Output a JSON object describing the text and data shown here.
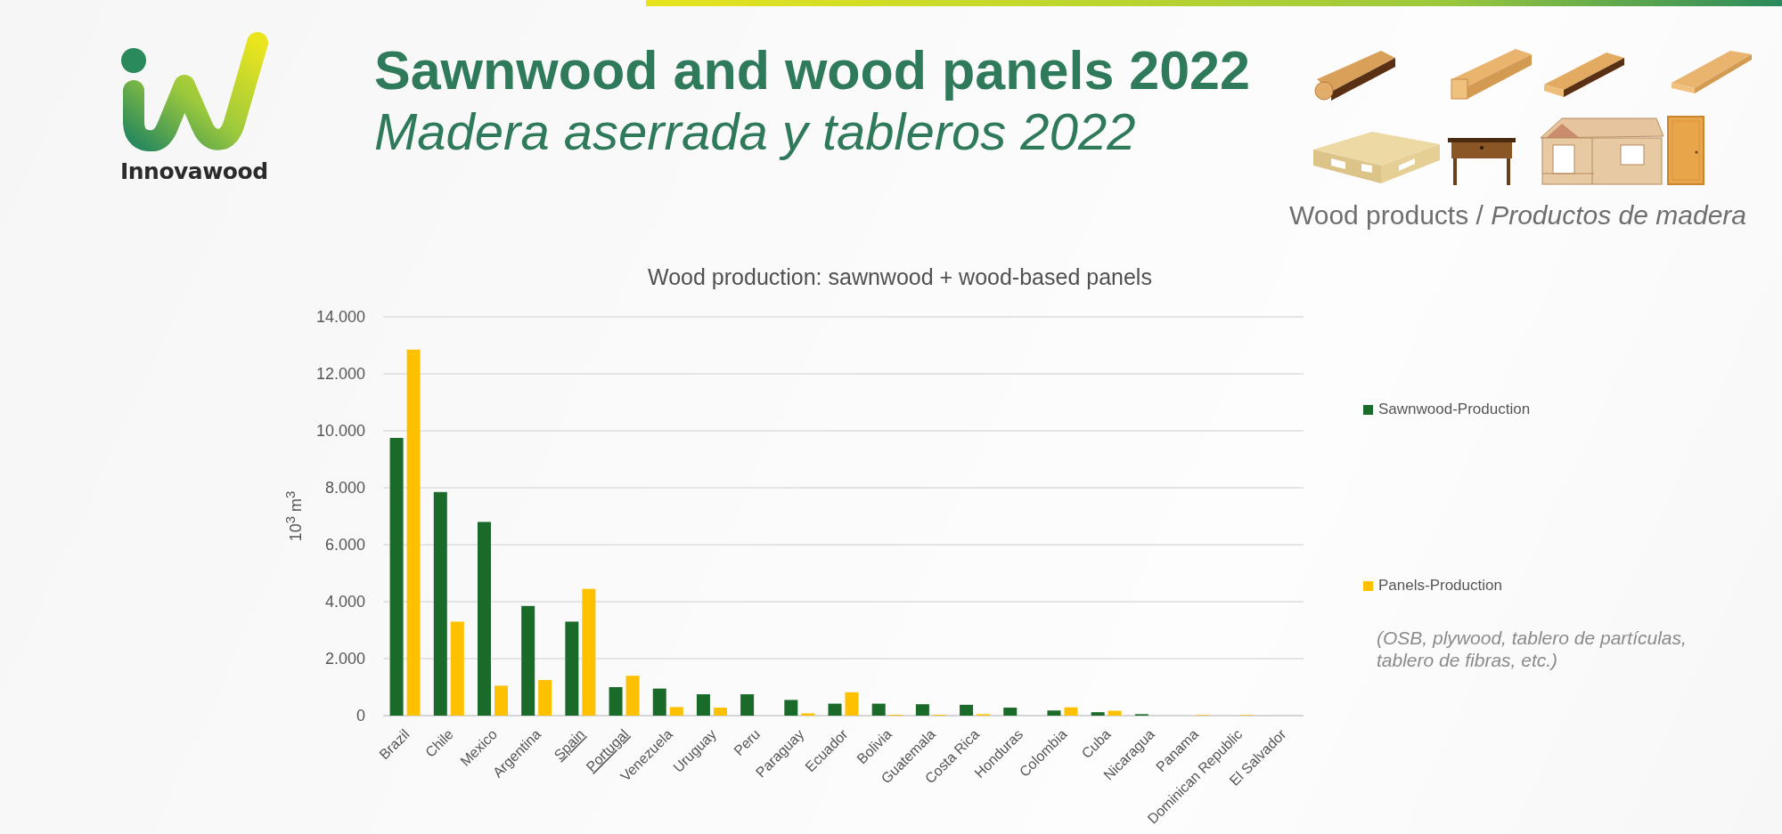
{
  "header": {
    "logo_text": "Innovawood",
    "title": "Sawnwood and wood panels 2022",
    "subtitle": "Madera aserrada y tableros 2022"
  },
  "products": {
    "caption": "Wood products / *Productos de madera*"
  },
  "chart": {
    "note": "(OSB, plywood, tablero de partículas, tablero de fibras, etc.)",
    "chart_data": {
      "type": "bar",
      "title": "Wood production: sawnwood + wood-based panels",
      "ylabel": "10$^{3}$ m$^{3}$",
      "categories": [
        "Brazil",
        "Chile",
        "Mexico",
        "Argentina",
        "Spain",
        "Portugal",
        "Venezuela",
        "Uruguay",
        "Peru",
        "Paraguay",
        "Ecuador",
        "Bolivia",
        "Guatemala",
        "Costa Rica",
        "Honduras",
        "Colombia",
        "Cuba",
        "Nicaragua",
        "Panama",
        "Dominican Republic",
        "El Salvador"
      ],
      "series": [
        {
          "name": "Sawnwood-Production",
          "color": "#1a6b2a",
          "values": [
            9750,
            7850,
            6800,
            3850,
            3300,
            1000,
            950,
            750,
            750,
            550,
            420,
            420,
            400,
            380,
            280,
            180,
            120,
            50,
            null,
            0,
            0
          ]
        },
        {
          "name": "Panels-Production",
          "color": "#ffc000",
          "values": [
            12850,
            3300,
            1050,
            1250,
            4450,
            1400,
            300,
            280,
            0,
            80,
            820,
            30,
            30,
            50,
            null,
            290,
            170,
            null,
            20,
            20,
            0
          ]
        }
      ],
      "ylim": [
        0,
        14000
      ],
      "grid": true,
      "legend": true,
      "yticks": [
        {
          "value": 0,
          "label": "0"
        },
        {
          "value": 2000,
          "label": "2.000"
        },
        {
          "value": 4000,
          "label": "4.000"
        },
        {
          "value": 6000,
          "label": "6.000"
        },
        {
          "value": 8000,
          "label": "8.000"
        },
        {
          "value": 10000,
          "label": "10.000"
        },
        {
          "value": 12000,
          "label": "12.000"
        },
        {
          "value": 14000,
          "label": "14.000"
        }
      ]
    },
    "category_underlines": [
      {
        "underlined": false
      },
      {
        "underlined": false
      },
      {
        "underlined": false
      },
      {
        "underlined": false
      },
      {
        "underlined": true
      },
      {
        "underlined": true
      },
      {
        "underlined": false
      },
      {
        "underlined": false
      },
      {
        "underlined": false
      },
      {
        "underlined": false
      },
      {
        "underlined": false
      },
      {
        "underlined": false
      },
      {
        "underlined": false
      },
      {
        "underlined": false
      },
      {
        "underlined": false
      },
      {
        "underlined": false
      },
      {
        "underlined": false
      },
      {
        "underlined": false
      },
      {
        "underlined": false
      },
      {
        "underlined": false
      },
      {
        "underlined": false
      }
    ]
  }
}
